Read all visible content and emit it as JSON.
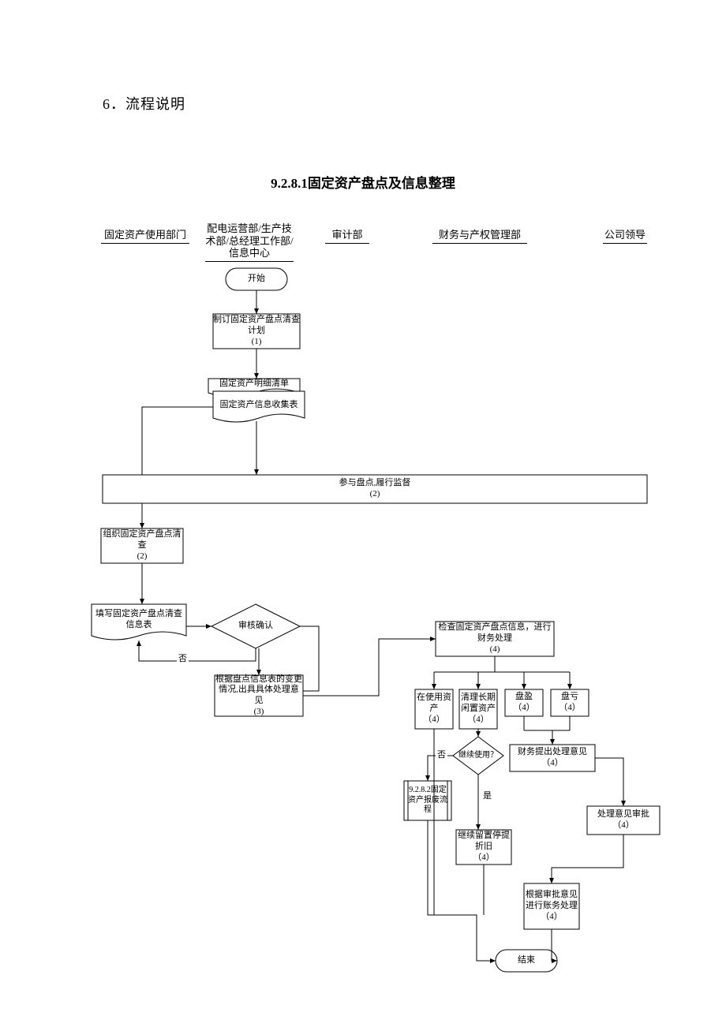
{
  "section_heading": "6．流程说明",
  "title": "9.2.8.1固定资产盘点及信息整理",
  "lanes": {
    "l1": "固定资产使用部门",
    "l2": "配电运营部/生产技术部/总经理工作部/信息中心",
    "l3": "审计部",
    "l4": "财务与产权管理部",
    "l5": "公司领导"
  },
  "nodes": {
    "start": "开始",
    "n1": "制订固定资产盘点清查计划\n(1)",
    "n_doc1a": "固定资产明细清单",
    "n_doc1b": "固定资产信息收集表",
    "n_wide_audit": "参与盘点,履行监督\n(2)",
    "n_org": "组织固定资产盘点清查\n(2)",
    "n_fill": "填写固定资产盘点清查信息表",
    "n_audit_confirm": "审核确认",
    "n_opinion": "根据盘点信息表的变更情况,出具具体处理意见\n(3)",
    "n_check": "检查固定资产盘点信息，进行财务处理\n(4)",
    "n_inuse": "在使用资产\n（4）",
    "n_idle": "清理长期闲置资产\n（4）",
    "n_surplus": "盘盈\n（4）",
    "n_deficit": "盘亏\n（4）",
    "n_continue_q": "继续使用？",
    "n_sub": "9.2.8.2固定资产报废流程",
    "n_keep": "继续留置停提折旧\n（4）",
    "n_fin_opinion": "财务提出处理意见\n（4）",
    "n_approve": "处理意见审批\n（4）",
    "n_acct": "根据审批意见进行账务处理\n（4）",
    "end": "结束"
  },
  "labels": {
    "no": "否",
    "yes": "是"
  },
  "chart_data": {
    "type": "flowchart",
    "swimlanes": [
      "固定资产使用部门",
      "配电运营部/生产技术部/总经理工作部/信息中心",
      "审计部",
      "财务与产权管理部",
      "公司领导"
    ],
    "nodes": [
      {
        "id": "start",
        "type": "terminator",
        "lane": 1,
        "label": "开始"
      },
      {
        "id": "n1",
        "type": "process",
        "lane": 1,
        "label": "制订固定资产盘点清查计划 (1)"
      },
      {
        "id": "doc1",
        "type": "document",
        "lane": 1,
        "label": "固定资产明细清单 / 固定资产信息收集表"
      },
      {
        "id": "audit_wide",
        "type": "process",
        "lane": 2,
        "span": [
          0,
          4
        ],
        "label": "参与盘点,履行监督 (2)"
      },
      {
        "id": "org",
        "type": "process",
        "lane": 0,
        "label": "组织固定资产盘点清查 (2)"
      },
      {
        "id": "fill",
        "type": "document",
        "lane": 0,
        "label": "填写固定资产盘点清查信息表"
      },
      {
        "id": "confirm",
        "type": "decision",
        "lane": 1,
        "label": "审核确认"
      },
      {
        "id": "opinion",
        "type": "process",
        "lane": 1,
        "label": "根据盘点信息表的变更情况,出具具体处理意见 (3)"
      },
      {
        "id": "check",
        "type": "process",
        "lane": 3,
        "label": "检查固定资产盘点信息，进行财务处理 (4)"
      },
      {
        "id": "inuse",
        "type": "process",
        "lane": 3,
        "label": "在使用资产 (4)"
      },
      {
        "id": "idle",
        "type": "process",
        "lane": 3,
        "label": "清理长期闲置资产 (4)"
      },
      {
        "id": "surplus",
        "type": "process",
        "lane": 3,
        "label": "盘盈 (4)"
      },
      {
        "id": "deficit",
        "type": "process",
        "lane": 3,
        "label": "盘亏 (4)"
      },
      {
        "id": "cont",
        "type": "decision",
        "lane": 3,
        "label": "继续使用？"
      },
      {
        "id": "sub",
        "type": "subprocess",
        "lane": 3,
        "label": "9.2.8.2 固定资产报废流程"
      },
      {
        "id": "keep",
        "type": "process",
        "lane": 3,
        "label": "继续留置停提折旧 (4)"
      },
      {
        "id": "finop",
        "type": "process",
        "lane": 3,
        "label": "财务提出处理意见 (4)"
      },
      {
        "id": "approve",
        "type": "process",
        "lane": 4,
        "label": "处理意见审批 (4)"
      },
      {
        "id": "acct",
        "type": "process",
        "lane": 3,
        "label": "根据审批意见进行账务处理 (4)"
      },
      {
        "id": "end",
        "type": "terminator",
        "lane": 3,
        "label": "结束"
      }
    ],
    "edges": [
      {
        "from": "start",
        "to": "n1"
      },
      {
        "from": "n1",
        "to": "doc1"
      },
      {
        "from": "doc1",
        "to": "audit_wide"
      },
      {
        "from": "doc1",
        "to": "org"
      },
      {
        "from": "audit_wide",
        "to": "org"
      },
      {
        "from": "org",
        "to": "fill"
      },
      {
        "from": "fill",
        "to": "confirm"
      },
      {
        "from": "confirm",
        "to": "fill",
        "label": "否"
      },
      {
        "from": "confirm",
        "to": "opinion"
      },
      {
        "from": "opinion",
        "to": "check"
      },
      {
        "from": "check",
        "to": "inuse"
      },
      {
        "from": "check",
        "to": "idle"
      },
      {
        "from": "check",
        "to": "surplus"
      },
      {
        "from": "check",
        "to": "deficit"
      },
      {
        "from": "idle",
        "to": "cont"
      },
      {
        "from": "cont",
        "to": "sub",
        "label": "否"
      },
      {
        "from": "cont",
        "to": "keep",
        "label": "是"
      },
      {
        "from": "surplus",
        "to": "finop"
      },
      {
        "from": "deficit",
        "to": "finop"
      },
      {
        "from": "finop",
        "to": "approve"
      },
      {
        "from": "approve",
        "to": "acct"
      },
      {
        "from": "inuse",
        "to": "end"
      },
      {
        "from": "sub",
        "to": "end"
      },
      {
        "from": "keep",
        "to": "end"
      },
      {
        "from": "acct",
        "to": "end"
      }
    ]
  }
}
